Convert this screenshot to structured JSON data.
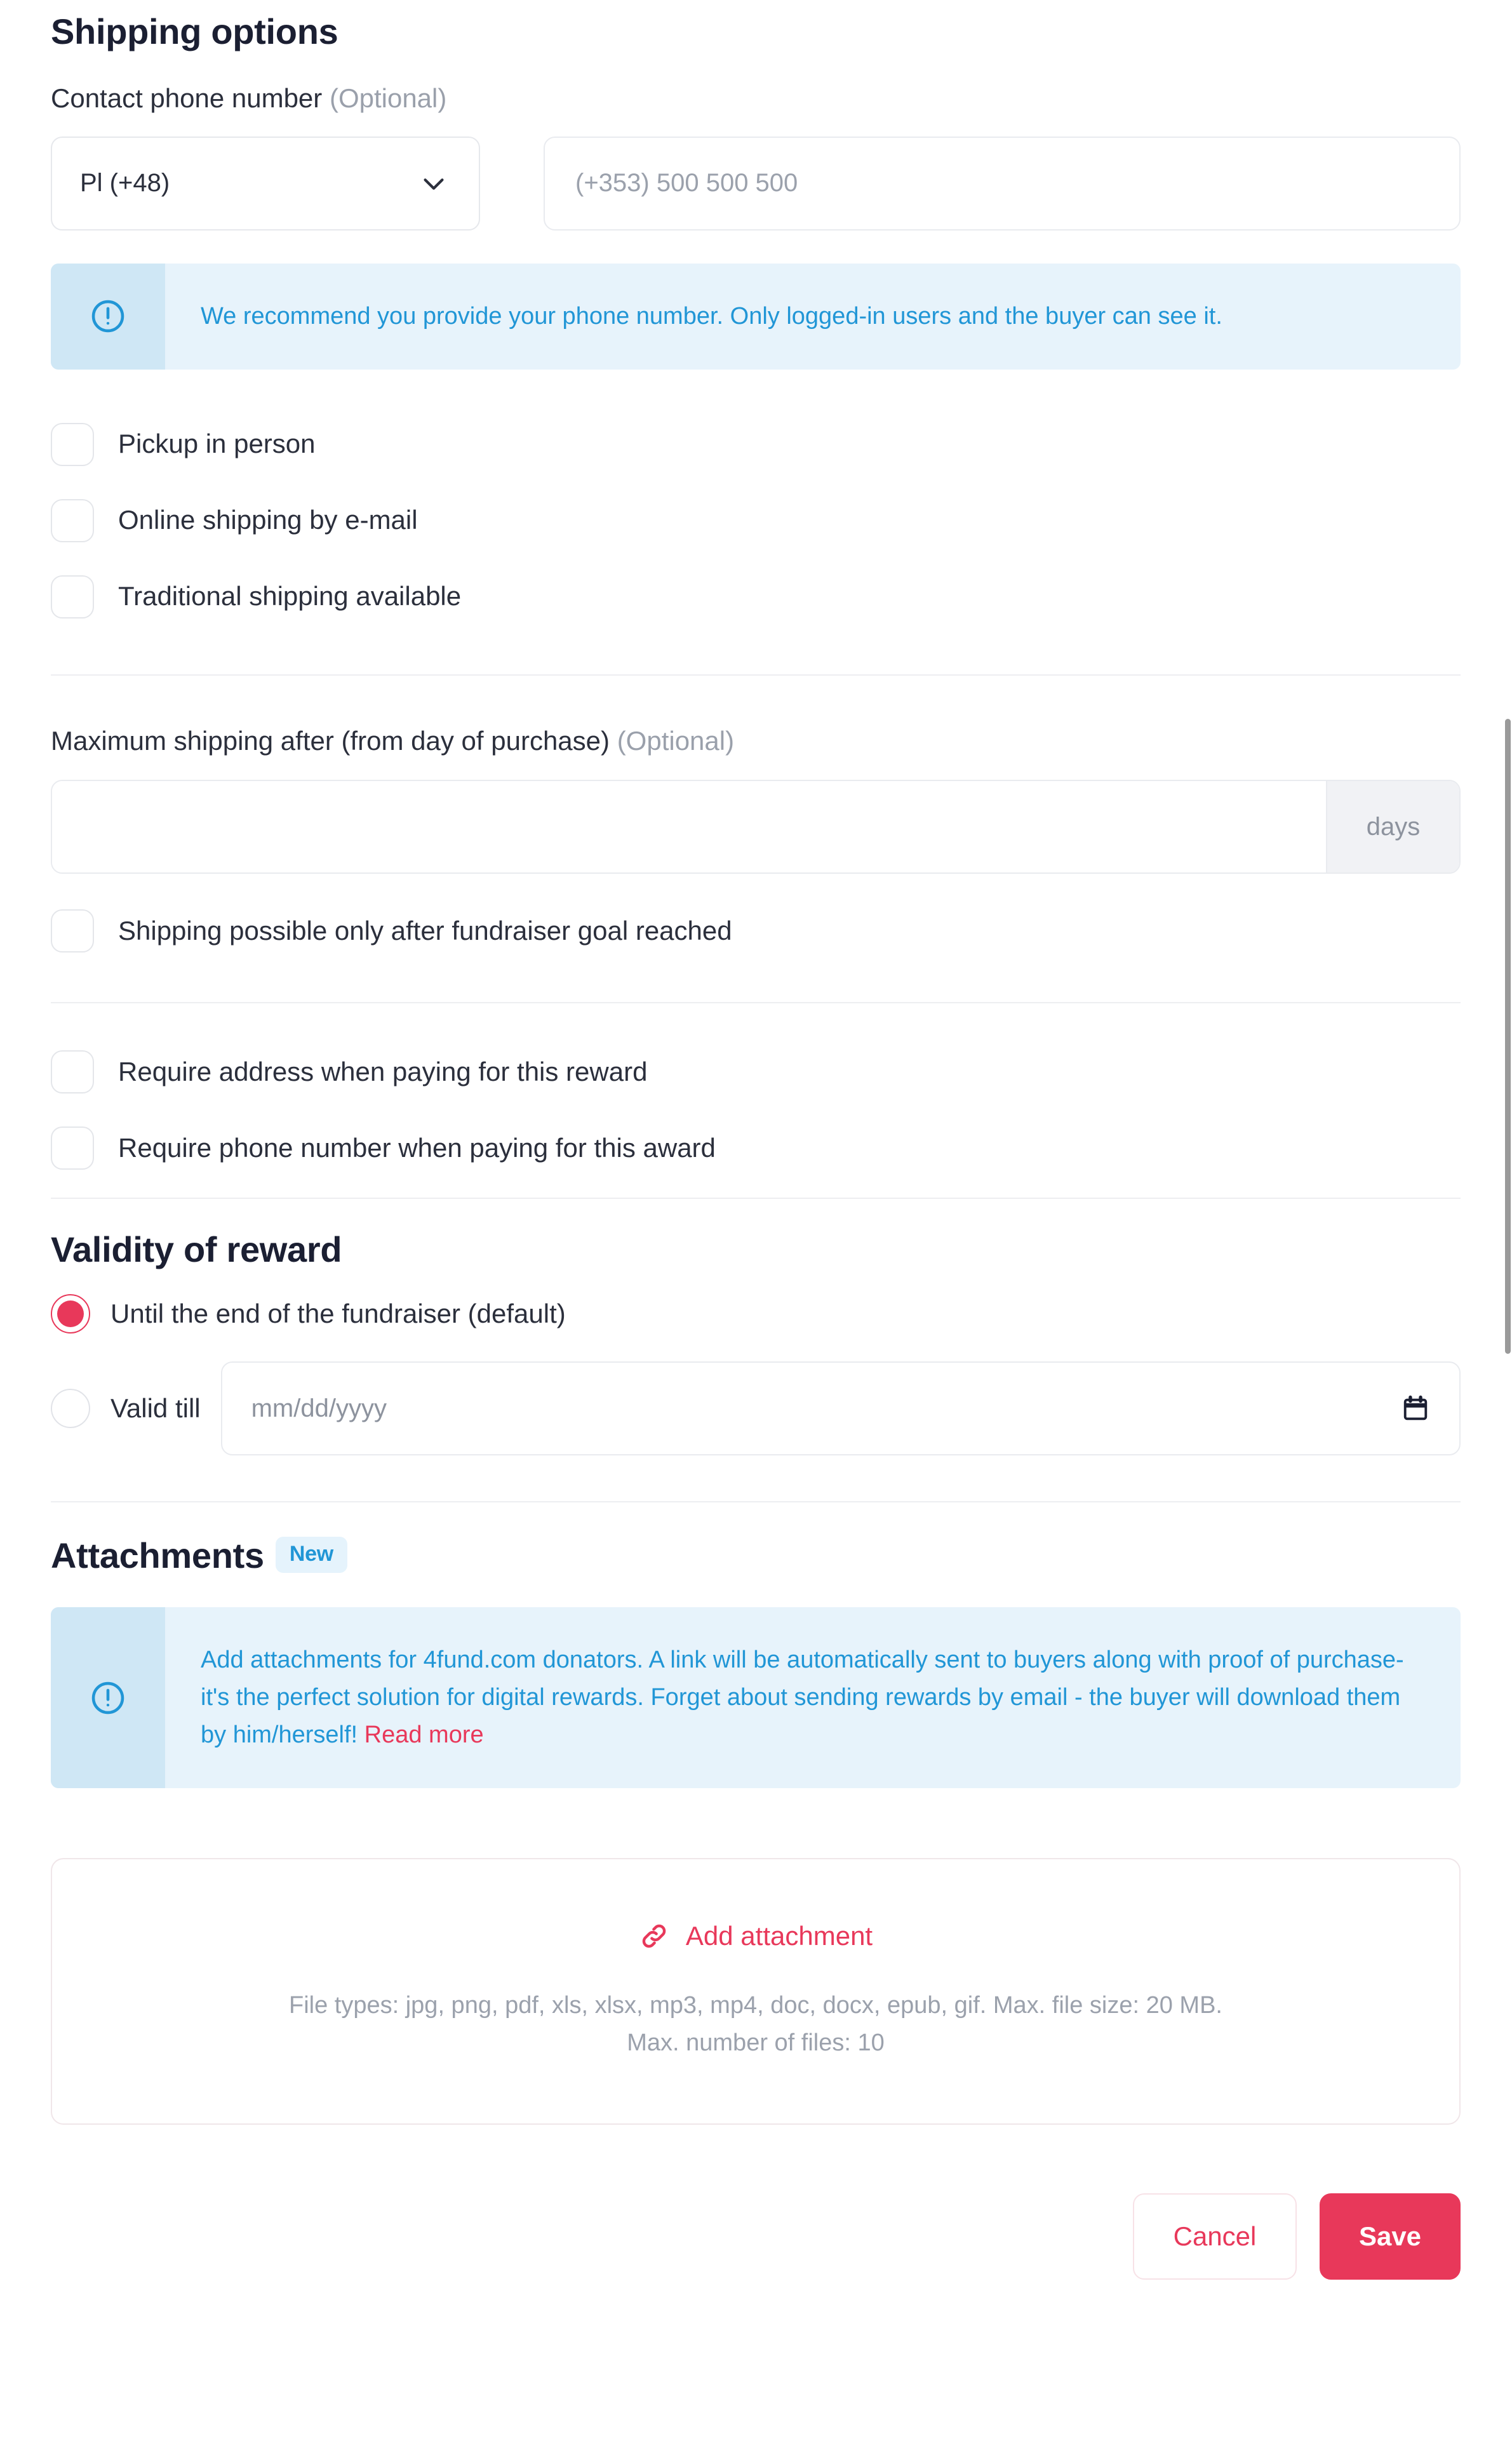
{
  "shipping": {
    "title": "Shipping options",
    "phone_label": "Contact phone number",
    "phone_label_optional": "(Optional)",
    "country_code_value": "Pl (+48)",
    "phone_placeholder": "(+353) 500 500 500",
    "phone_notice": "We recommend you provide your phone number. Only logged-in users and the buyer can see it.",
    "options": [
      {
        "label": "Pickup in person",
        "checked": false
      },
      {
        "label": "Online shipping by e-mail",
        "checked": false
      },
      {
        "label": "Traditional shipping available",
        "checked": false
      }
    ],
    "max_shipping_label": "Maximum shipping after (from day of purchase)",
    "max_shipping_label_optional": "(Optional)",
    "max_shipping_value": "",
    "max_shipping_placeholder": "",
    "days_suffix": "days",
    "goal_option": {
      "label": "Shipping possible only after fundraiser goal reached",
      "checked": false
    },
    "require_options": [
      {
        "label": "Require address when paying for this reward",
        "checked": false
      },
      {
        "label": "Require phone number when paying for this award",
        "checked": false
      }
    ]
  },
  "validity": {
    "title": "Validity of reward",
    "default_option": "Until the end of the fundraiser (default)",
    "valid_till_label": "Valid till",
    "date_placeholder": "mm/dd/yyyy",
    "date_value": ""
  },
  "attachments": {
    "title": "Attachments",
    "badge": "New",
    "notice_part1": "Add attachments for 4fund.com donators. A link will be automatically sent to buyers along with proof of purchase- it's the perfect solution for digital rewards. Forget about sending rewards by email - the buyer will download them by him/herself! ",
    "notice_link": "Read more",
    "add_label": "Add attachment",
    "file_types_line": "File types: jpg, png, pdf, xls, xlsx, mp3, mp4, doc, docx, epub, gif. Max. file size: 20 MB.",
    "max_files_line": "Max. number of files: 10"
  },
  "footer": {
    "cancel_label": "Cancel",
    "save_label": "Save"
  },
  "colors": {
    "accent": "#e8385a",
    "info_text": "#2196d6",
    "info_bg": "#e7f3fb",
    "info_icon_bg": "#cfe7f5",
    "heading": "#1b1f32"
  }
}
